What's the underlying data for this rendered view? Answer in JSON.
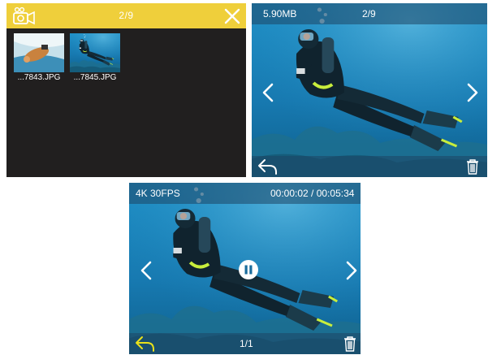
{
  "browser": {
    "counter": "2/9",
    "files": [
      "...7843.JPG",
      "...7845.JPG"
    ],
    "colors": {
      "bar": "#efcf3b",
      "bg": "#211f1f"
    },
    "icons": [
      "camera-mode-icon",
      "close-icon"
    ]
  },
  "photo_view": {
    "file_size": "5.90MB",
    "counter": "2/9",
    "icons": [
      "chevron-left-icon",
      "chevron-right-icon",
      "back-arrow-icon",
      "trash-icon"
    ]
  },
  "video_view": {
    "resolution": "4K 30FPS",
    "time": "00:00:02 / 00:05:34",
    "counter": "1/1",
    "icons": [
      "chevron-left-icon",
      "chevron-right-icon",
      "pause-icon",
      "back-arrow-icon",
      "trash-icon"
    ],
    "colors": {
      "back_arrow": "#e9e11a"
    }
  }
}
